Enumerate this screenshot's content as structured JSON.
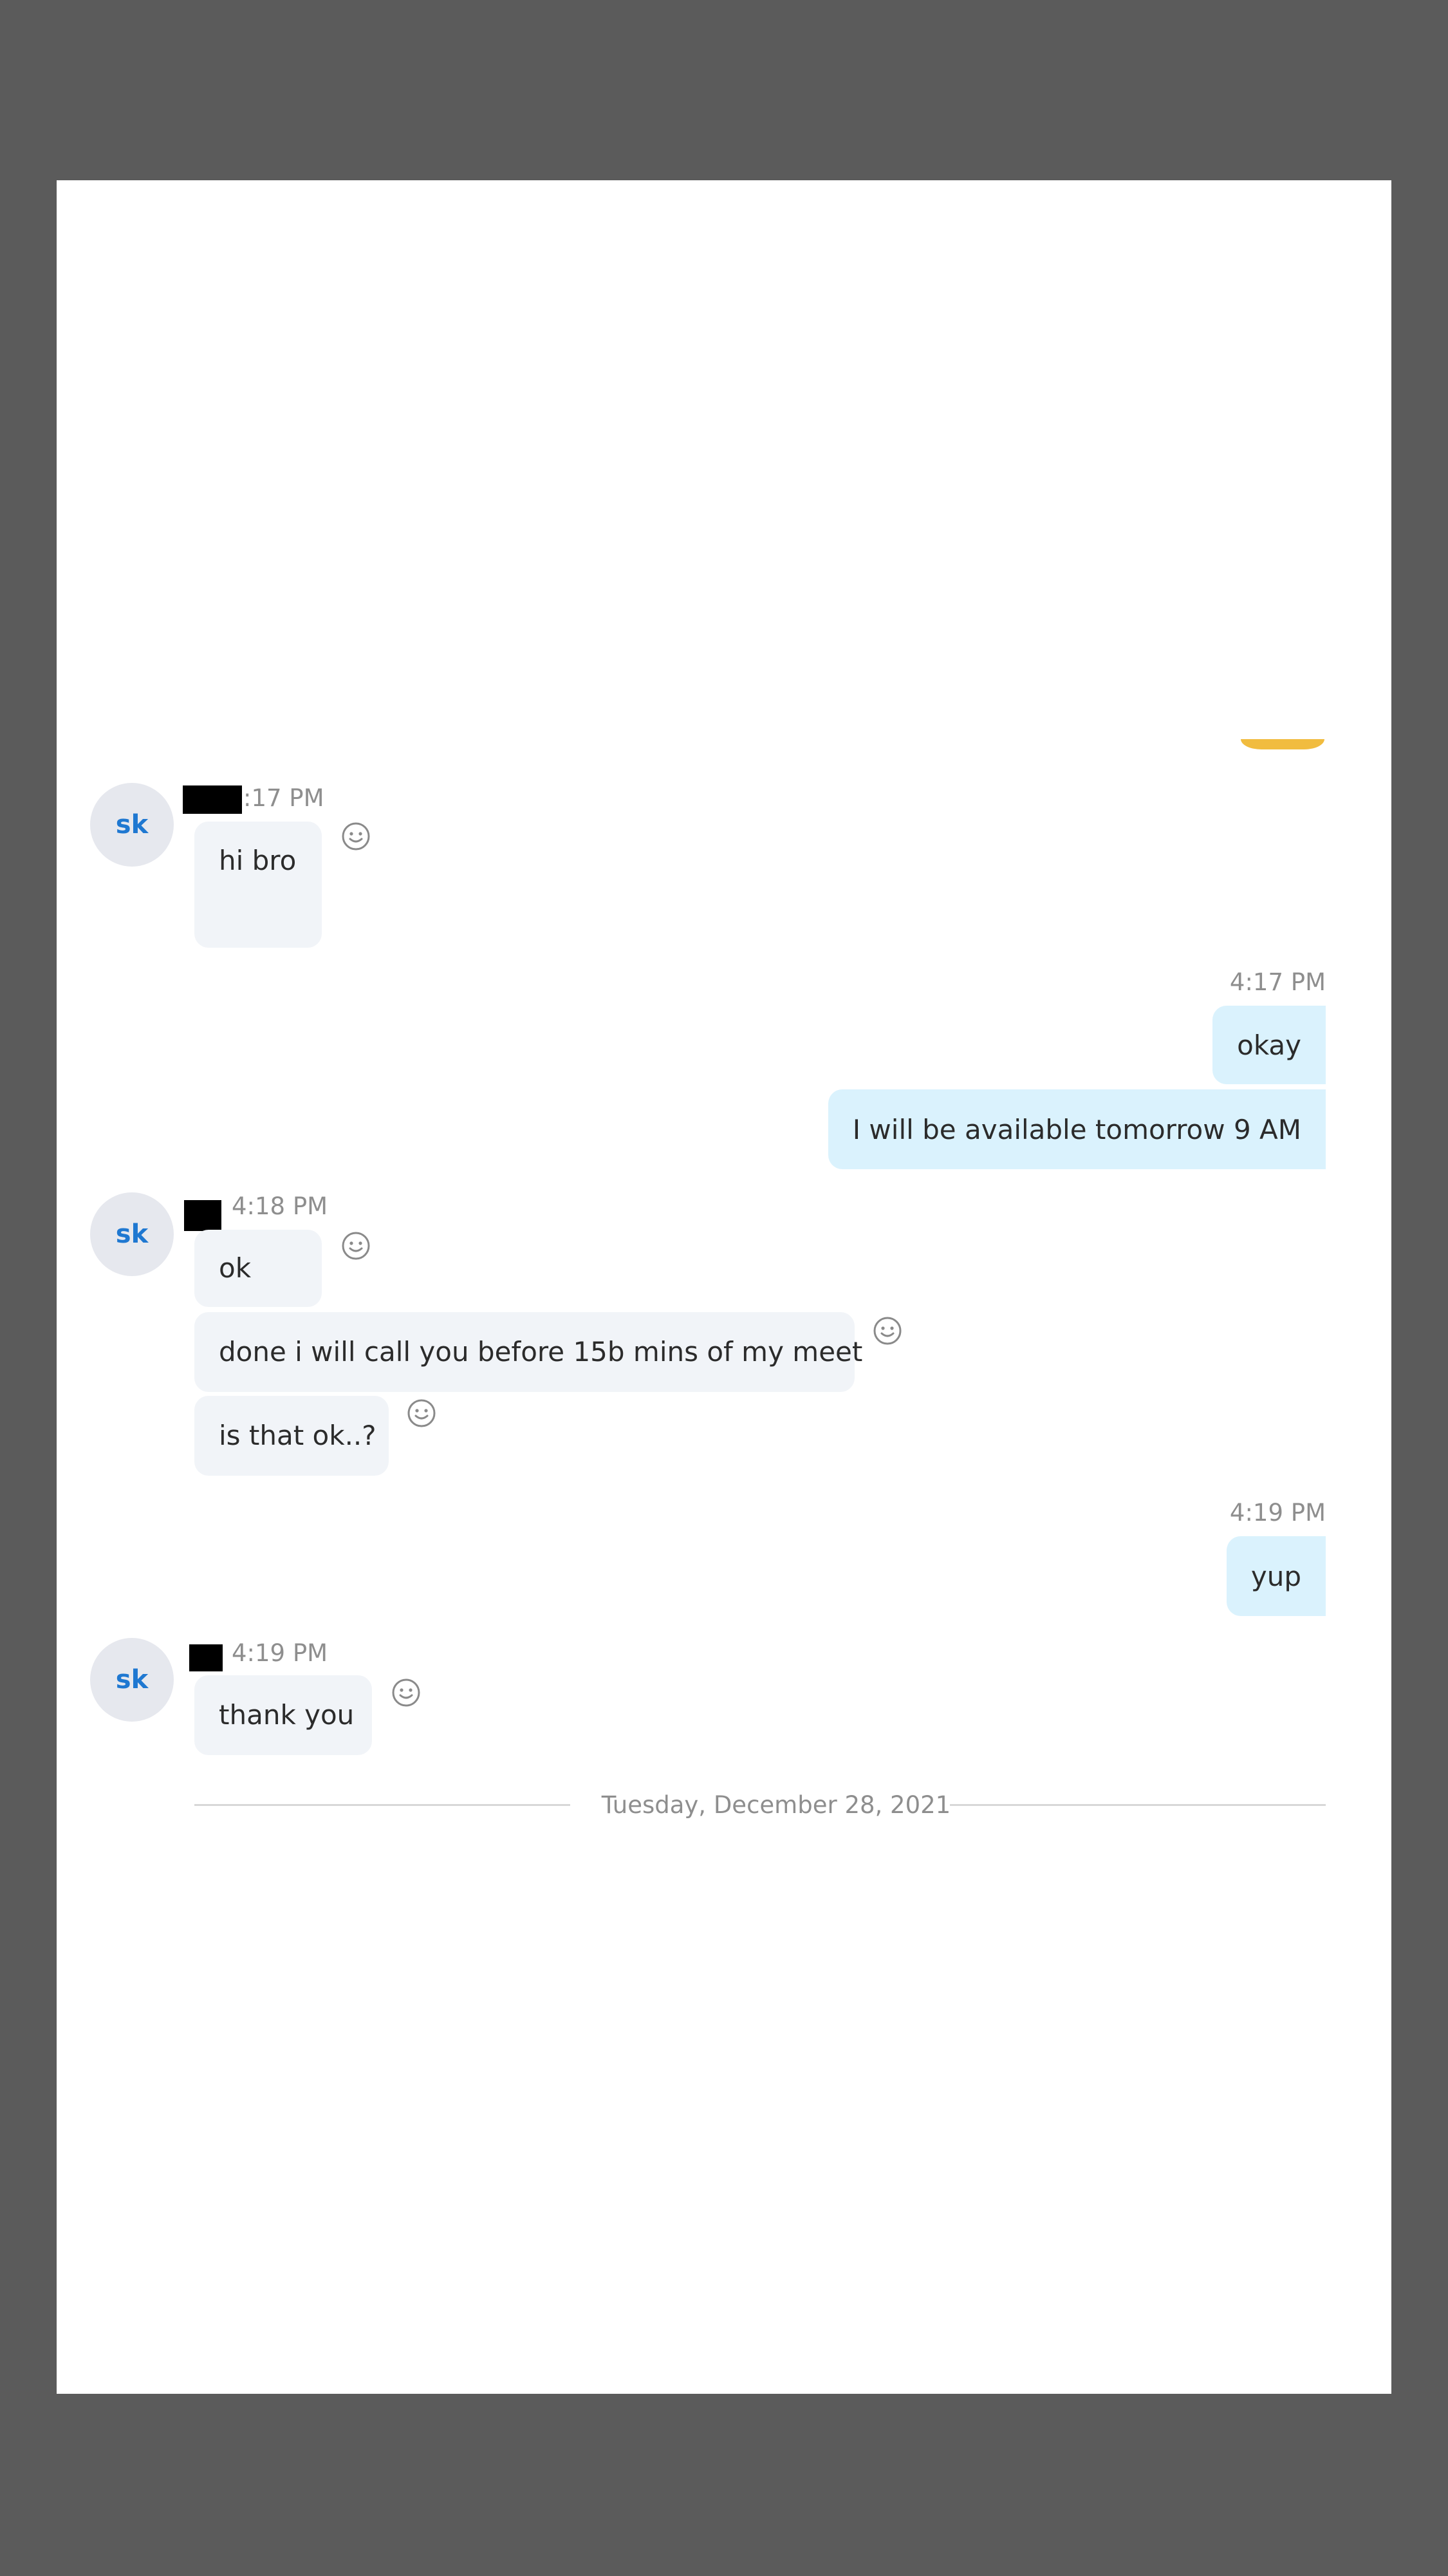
{
  "messages": {
    "group1": {
      "avatar": "sk",
      "time_suffix": ":17 PM",
      "text": "hi bro"
    },
    "out1": {
      "time": "4:17 PM",
      "line1": "okay",
      "line2": "I will be available tomorrow 9 AM"
    },
    "group2": {
      "avatar": "sk",
      "time": "4:18 PM",
      "line1": "ok",
      "line2": "done i will call you before 15b mins of my meet",
      "line3": "is that ok..?"
    },
    "out2": {
      "time": "4:19 PM",
      "line1": "yup"
    },
    "group3": {
      "avatar": "sk",
      "time": "4:19 PM",
      "line1": "thank you"
    }
  },
  "date_separator": "Tuesday, December 28, 2021",
  "icons": {
    "reaction": "smiley-face-icon",
    "redaction": "black-box"
  },
  "colors": {
    "backdrop": "#5b5b5b",
    "incoming_bubble": "#f1f4f8",
    "outgoing_bubble": "#daf2fd",
    "avatar_text": "#1f78d1"
  }
}
